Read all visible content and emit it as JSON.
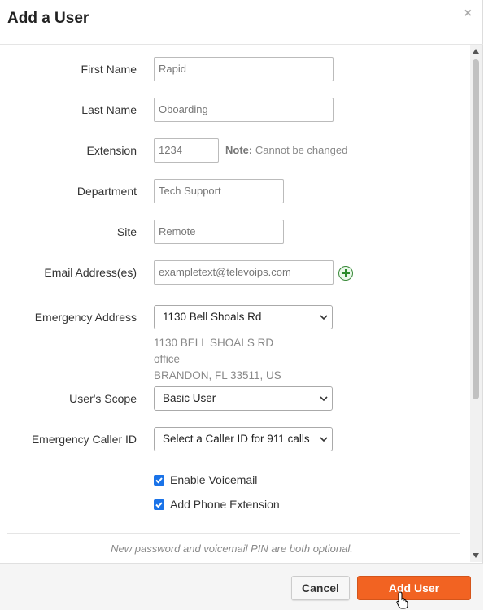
{
  "dialog": {
    "title": "Add a User",
    "close_glyph": "×"
  },
  "form": {
    "first_name": {
      "label": "First Name",
      "value": "Rapid"
    },
    "last_name": {
      "label": "Last Name",
      "value": "Oboarding"
    },
    "extension": {
      "label": "Extension",
      "value": "1234",
      "note_bold": "Note:",
      "note_text": " Cannot be changed"
    },
    "department": {
      "label": "Department",
      "value": "Tech Support"
    },
    "site": {
      "label": "Site",
      "value": "Remote"
    },
    "email": {
      "label": "Email Address(es)",
      "value": "exampletext@televoips.com",
      "add_icon": "plus-circle-icon"
    },
    "emergency_address": {
      "label": "Emergency Address",
      "selected": "1130 Bell Shoals Rd",
      "details": [
        "1130 BELL SHOALS RD",
        "office",
        "BRANDON, FL 33511, US"
      ]
    },
    "scope": {
      "label": "User's Scope",
      "selected": "Basic User"
    },
    "caller_id": {
      "label": "Emergency Caller ID",
      "selected": "Select a Caller ID for 911 calls"
    },
    "enable_voicemail": {
      "label": "Enable Voicemail",
      "checked": true
    },
    "add_phone_extension": {
      "label": "Add Phone Extension",
      "checked": true
    },
    "password_note": "New password and voicemail PIN are both optional."
  },
  "footer": {
    "cancel_label": "Cancel",
    "submit_label": "Add User"
  },
  "colors": {
    "accent": "#f26322",
    "checkbox": "#1a73e8",
    "add_icon": "#2a8a2a"
  }
}
